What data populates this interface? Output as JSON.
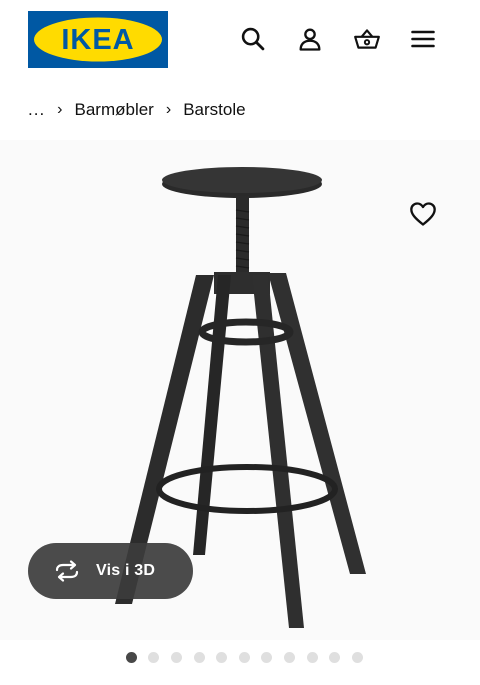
{
  "header": {
    "logo_text": "IKEA",
    "logo_colors": {
      "blue": "#0058A3",
      "yellow": "#FFDB00"
    },
    "icons": [
      "search-icon",
      "user-icon",
      "basket-icon",
      "menu-icon"
    ]
  },
  "breadcrumb": {
    "ellipsis": "...",
    "items": [
      {
        "label": "Barmøbler"
      },
      {
        "label": "Barstole"
      }
    ]
  },
  "product": {
    "image_subject": "black swivel bar stool",
    "favorite_icon": "heart-icon",
    "view3d_label": "Vis i 3D",
    "view3d_icon": "rotate-icon"
  },
  "carousel": {
    "total": 11,
    "active_index": 0
  }
}
